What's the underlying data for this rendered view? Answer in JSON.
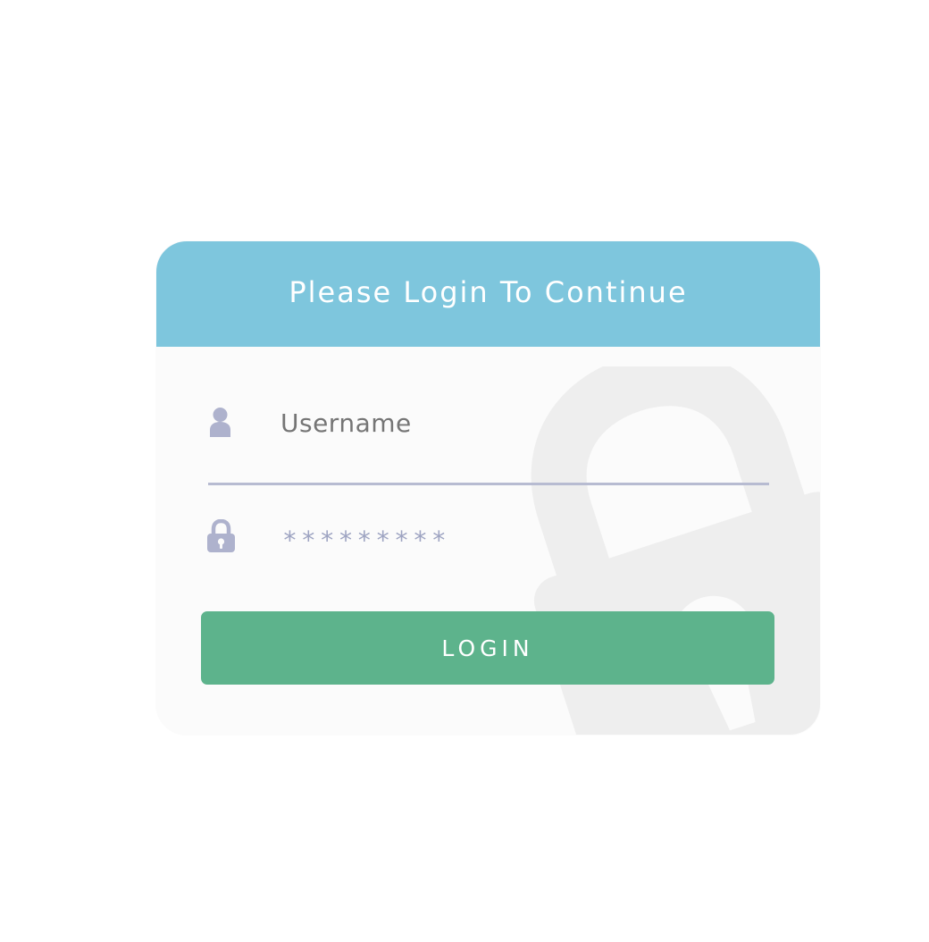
{
  "login_form": {
    "title": "Please Login To Continue",
    "username": {
      "placeholder": "Username",
      "icon": "user-icon"
    },
    "password": {
      "value": "*********",
      "icon": "lock-icon"
    },
    "button_label": "LOGIN"
  },
  "colors": {
    "header": "#7ec6dd",
    "card": "#fbfbfb",
    "button": "#5db38c",
    "field_text": "#9ea4c2",
    "divider": "#b7bbd1",
    "background_lock": "#eeeeee"
  },
  "decorations": {
    "background_icon": "large-padlock-icon"
  }
}
